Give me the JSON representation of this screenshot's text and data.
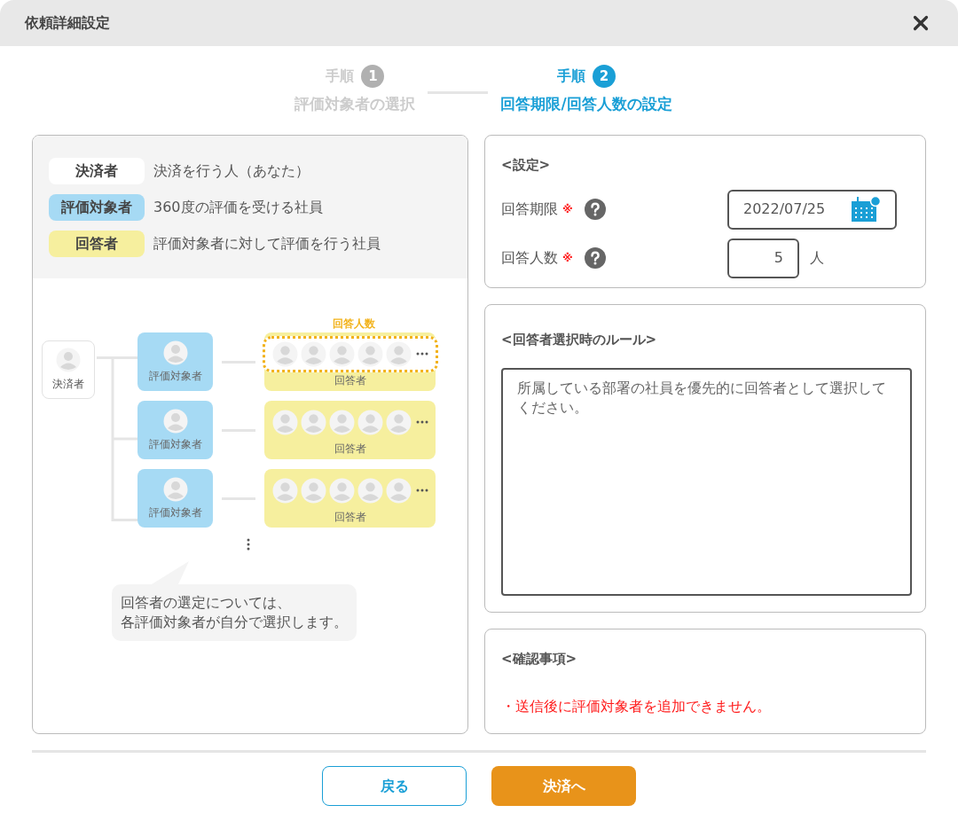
{
  "window": {
    "title": "依頼詳細設定"
  },
  "steps": [
    {
      "label": "手順",
      "number": "1",
      "caption": "評価対象者の選択",
      "selected": false
    },
    {
      "label": "手順",
      "number": "2",
      "caption": "回答期限/回答人数の設定",
      "selected": true
    }
  ],
  "legend": [
    {
      "kind": "approver",
      "tag": "決済者",
      "description": "決済を行う人（あなた）"
    },
    {
      "kind": "evaluatee",
      "tag": "評価対象者",
      "description": "360度の評価を受ける社員"
    },
    {
      "kind": "respondent",
      "tag": "回答者",
      "description": "評価対象者に対して評価を行う社員"
    }
  ],
  "diagram": {
    "approver_label": "決済者",
    "count_label": "回答人数",
    "rows": [
      {
        "evaluatee_label": "評価対象者",
        "respondent_label": "回答者",
        "highlighted": true
      },
      {
        "evaluatee_label": "評価対象者",
        "respondent_label": "回答者",
        "highlighted": false
      },
      {
        "evaluatee_label": "評価対象者",
        "respondent_label": "回答者",
        "highlighted": false
      }
    ],
    "note": [
      "回答者の選定については、",
      "各評価対象者が自分で選択します。"
    ]
  },
  "settings": {
    "title": "<設定>",
    "fields": [
      {
        "kind": "date",
        "label": "回答期限",
        "required_mark": "※",
        "value": "2022/07/25"
      },
      {
        "kind": "number",
        "label": "回答人数",
        "required_mark": "※",
        "value": "5",
        "unit": "人"
      }
    ]
  },
  "rules": {
    "title": "<回答者選択時のルール>",
    "value": "所属している部署の社員を優先的に回答者として選択してください。"
  },
  "confirm": {
    "title": "<確認事項>",
    "items": [
      "・送信後に評価対象者を追加できません。"
    ]
  },
  "buttons": [
    {
      "kind": "secondary",
      "label": "戻る"
    },
    {
      "kind": "primary",
      "label": "決済へ"
    }
  ]
}
